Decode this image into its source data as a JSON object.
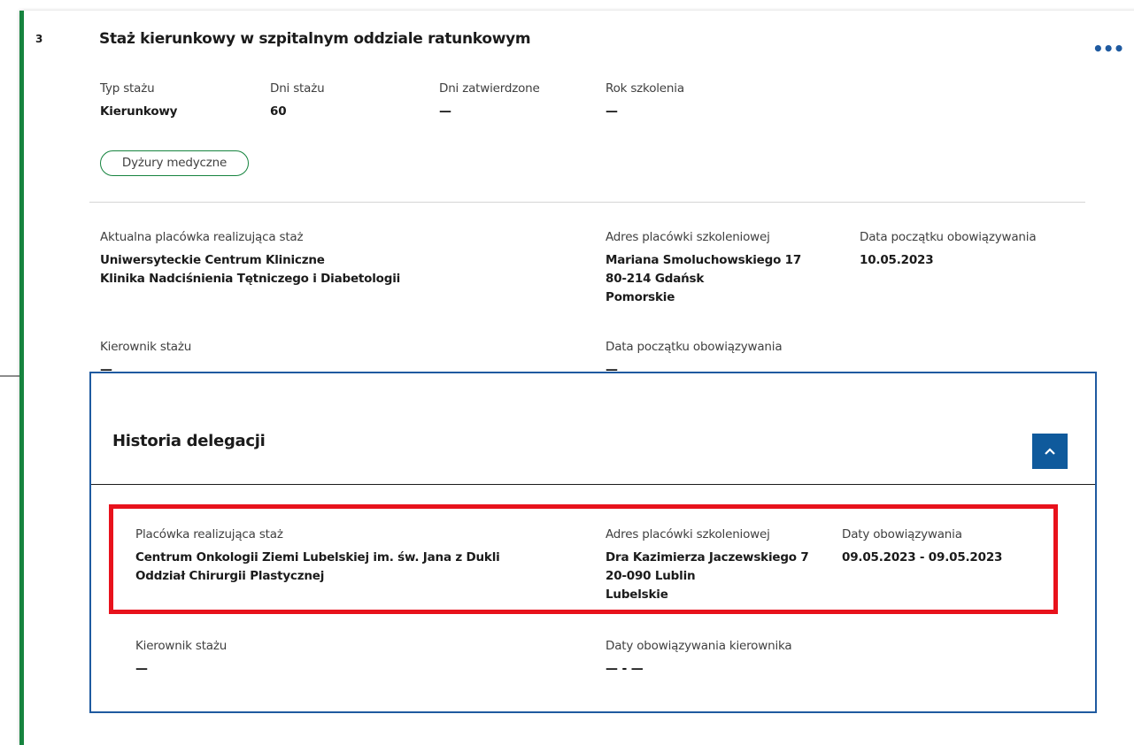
{
  "card": {
    "number": "3",
    "title": "Staż kierunkowy w szpitalnym oddziale ratunkowym",
    "menu_icon": "more-horizontal-icon",
    "fields": {
      "typ_label": "Typ stażu",
      "typ_value": "Kierunkowy",
      "dni_label": "Dni stażu",
      "dni_value": "60",
      "zatw_label": "Dni zatwierdzone",
      "zatw_value": "—",
      "rok_label": "Rok szkolenia",
      "rok_value": "—"
    },
    "tag": "Dyżury medyczne",
    "placowka_label": "Aktualna placówka realizująca staż",
    "placowka_line1": "Uniwersyteckie Centrum Kliniczne",
    "placowka_line2": "Klinika Nadciśnienia Tętniczego i Diabetologii",
    "adres_label": "Adres placówki szkoleniowej",
    "adres_line1": "Mariana Smoluchowskiego 17",
    "adres_line2": "80-214 Gdańsk",
    "adres_line3": "Pomorskie",
    "data_label": "Data początku obowiązywania",
    "data_value": "10.05.2023",
    "kierownik_label": "Kierownik stażu",
    "kierownik_value": "—",
    "kierownik_data_label": "Data początku obowiązywania",
    "kierownik_data_value": "—"
  },
  "history": {
    "title": "Historia delegacji",
    "collapse_icon": "chevron-up-icon",
    "placowka_label": "Placówka realizująca staż",
    "placowka_line1": "Centrum Onkologii Ziemi Lubelskiej im. św. Jana z Dukli",
    "placowka_line2": "Oddział Chirurgii Plastycznej",
    "adres_label": "Adres placówki szkoleniowej",
    "adres_line1": "Dra Kazimierza Jaczewskiego 7",
    "adres_line2": "20-090 Lublin",
    "adres_line3": "Lubelskie",
    "daty_label": "Daty obowiązywania",
    "daty_value": "09.05.2023 - 09.05.2023",
    "kierownik_label": "Kierownik stażu",
    "kierownik_value": "—",
    "kierownik_daty_label": "Daty obowiązywania kierownika",
    "kierownik_daty_value": "— - —"
  },
  "colors": {
    "accent_green": "#16843f",
    "accent_blue": "#1f5aa0",
    "highlight_red": "#e8121c"
  }
}
